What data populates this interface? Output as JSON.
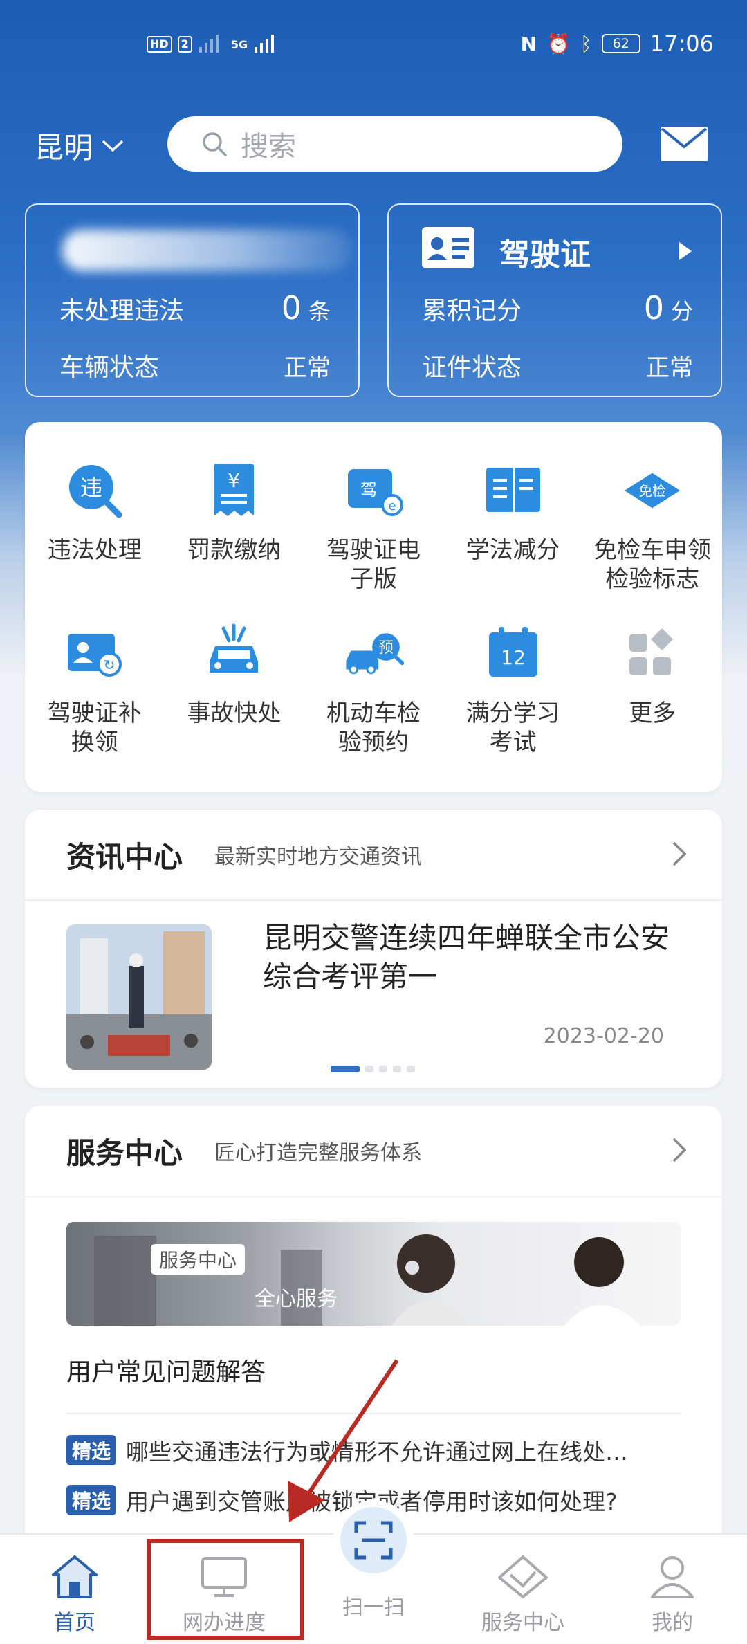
{
  "status_bar": {
    "left_indicators": [
      "HD",
      "2",
      "5G"
    ],
    "battery": "62",
    "time": "17:06"
  },
  "header": {
    "city": "昆明",
    "search_placeholder": "搜索"
  },
  "vehicle_card": {
    "violations_label": "未处理违法",
    "violations_count": "0",
    "violations_unit": "条",
    "status_label": "车辆状态",
    "status_value": "正常"
  },
  "license_card": {
    "title": "驾驶证",
    "points_label": "累积记分",
    "points_value": "0",
    "points_unit": "分",
    "status_label": "证件状态",
    "status_value": "正常"
  },
  "services": [
    {
      "label": "违法处理",
      "icon": "violation-magnifier-icon"
    },
    {
      "label": "罚款缴纳",
      "icon": "fine-receipt-icon"
    },
    {
      "label": "驾驶证电\n子版",
      "icon": "e-license-icon"
    },
    {
      "label": "学法减分",
      "icon": "open-book-icon"
    },
    {
      "label": "免检车申领\n检验标志",
      "icon": "inspection-exempt-icon"
    },
    {
      "label": "驾驶证补\n换领",
      "icon": "license-renewal-icon"
    },
    {
      "label": "事故快处",
      "icon": "car-accident-icon"
    },
    {
      "label": "机动车检\n验预约",
      "icon": "vehicle-inspection-appointment-icon"
    },
    {
      "label": "满分学习\n考试",
      "icon": "calendar-12-icon"
    },
    {
      "label": "更多",
      "icon": "more-grid-icon"
    }
  ],
  "news": {
    "title": "资讯中心",
    "subtitle": "最新实时地方交通资讯",
    "headline": "昆明交警连续四年蝉联全市公安综合考评第一",
    "date": "2023-02-20"
  },
  "service_center": {
    "title": "服务中心",
    "subtitle": "匠心打造完整服务体系",
    "banner_tag": "服务中心",
    "banner_text": "全心服务",
    "faq_title": "用户常见问题解答",
    "faq": [
      {
        "tag": "精选",
        "text": "哪些交通违法行为或情形不允许通过网上在线处…"
      },
      {
        "tag": "精选",
        "text": "用户遇到交管账户被锁定或者停用时该如何处理?"
      }
    ]
  },
  "bottom_nav": [
    {
      "label": "首页",
      "icon": "home-icon",
      "active": true
    },
    {
      "label": "网办进度",
      "icon": "monitor-icon",
      "active": false
    },
    {
      "label": "扫一扫",
      "icon": "scan-icon",
      "active": false
    },
    {
      "label": "服务中心",
      "icon": "service-diamond-icon",
      "active": false
    },
    {
      "label": "我的",
      "icon": "user-icon",
      "active": false
    }
  ],
  "colors": {
    "brand_blue": "#2a5fae",
    "highlight_red": "#b92a24"
  }
}
